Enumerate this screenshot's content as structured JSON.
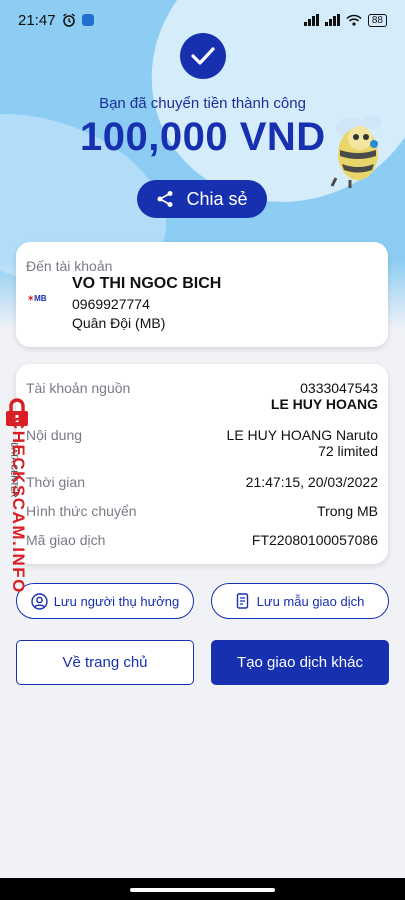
{
  "status_bar": {
    "time": "21:47",
    "battery": "88"
  },
  "header": {
    "subtitle": "Bạn đã chuyển tiền thành công",
    "amount": "100,000 VND",
    "share_label": "Chia sẻ"
  },
  "recipient": {
    "label": "Đến tài khoản",
    "bank_logo": "MB",
    "name": "VO THI NGOC BICH",
    "phone": "0969927774",
    "bank": "Quân Đội (MB)"
  },
  "details": {
    "source_label": "Tài khoản nguồn",
    "source_account": "0333047543",
    "source_name": "LE HUY HOANG",
    "content_label": "Nội dung",
    "content_line1": "LE HUY HOANG Naruto",
    "content_line2": "72 limited",
    "time_label": "Thời gian",
    "time_value": "21:47:15, 20/03/2022",
    "method_label": "Hình thức chuyển",
    "method_value": "Trong MB",
    "txn_label": "Mã giao dịch",
    "txn_value": "FT22080100057086"
  },
  "actions": {
    "save_beneficiary": "Lưu người thụ hưởng",
    "save_template": "Lưu mẫu giao dịch",
    "home": "Về trang chủ",
    "new_transaction": "Tạo giao dịch khác"
  },
  "watermark": {
    "main": "CHECKSCAM.INFO",
    "small": "DATA CENTER"
  },
  "colors": {
    "primary": "#1730b0",
    "sky": "#8dcdf3",
    "watermark": "#d81f26"
  }
}
